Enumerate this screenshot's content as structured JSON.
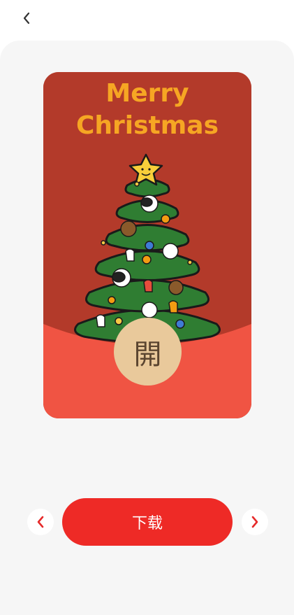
{
  "header": {
    "back_icon": "chevron-left-icon"
  },
  "card": {
    "greeting_line1": "Merry",
    "greeting_line2": "Christmas",
    "open_button_label": "開",
    "colors": {
      "card_red": "#b33a2a",
      "card_bottom": "#f05443",
      "title_yellow": "#f6a623",
      "tree_green": "#2f7d32",
      "open_circle": "#e9c99b"
    }
  },
  "controls": {
    "prev_icon": "chevron-left-icon",
    "next_icon": "chevron-right-icon",
    "download_label": "下载",
    "accent": "#ee2a26"
  }
}
